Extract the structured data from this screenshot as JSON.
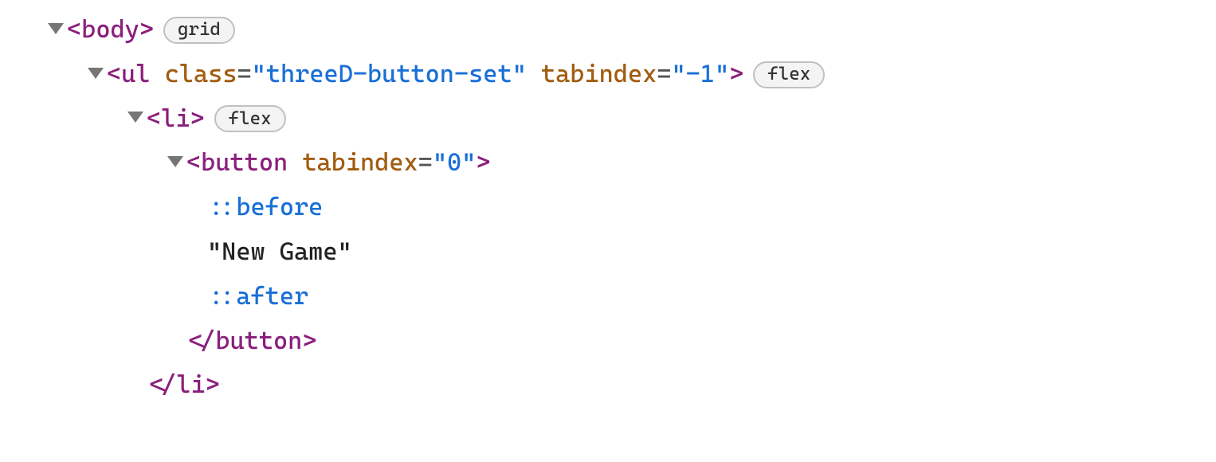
{
  "tree": {
    "line1": {
      "open": "<",
      "tag": "body",
      "close": ">",
      "badge": "grid"
    },
    "line2": {
      "open": "<",
      "tag": "ul",
      "attr1_name": "class",
      "attr1_eq": "=",
      "attr1_val": "\"threeD-button-set\"",
      "attr2_name": "tabindex",
      "attr2_eq": "=",
      "attr2_val": "\"-1\"",
      "close": ">",
      "badge": "flex"
    },
    "line3": {
      "open": "<",
      "tag": "li",
      "close": ">",
      "badge": "flex"
    },
    "line4": {
      "open": "<",
      "tag": "button",
      "attr1_name": "tabindex",
      "attr1_eq": "=",
      "attr1_val": "\"0\"",
      "close": ">"
    },
    "line5": {
      "pseudo": "::before"
    },
    "line6": {
      "text": "\"New Game\""
    },
    "line7": {
      "pseudo": "::after"
    },
    "line8": {
      "open": "</",
      "tag": "button",
      "close": ">"
    },
    "line9": {
      "open": "</",
      "tag": "li",
      "close": ">"
    }
  }
}
